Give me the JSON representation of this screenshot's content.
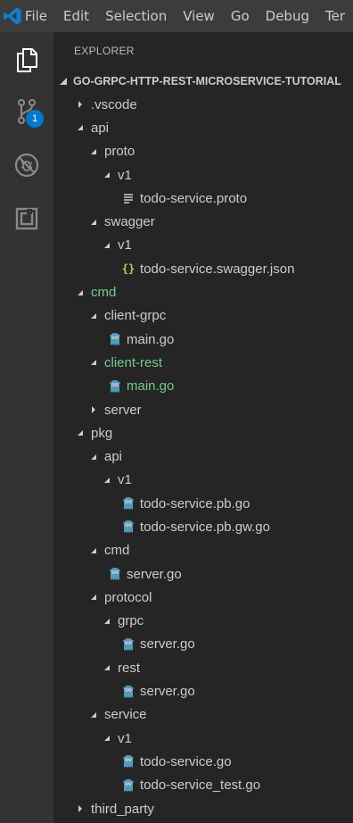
{
  "menu": [
    "File",
    "Edit",
    "Selection",
    "View",
    "Go",
    "Debug",
    "Ter"
  ],
  "activity": {
    "items": [
      {
        "name": "explorer-icon"
      },
      {
        "name": "source-control-icon",
        "badge": "1"
      },
      {
        "name": "debug-icon"
      },
      {
        "name": "extensions-icon"
      }
    ]
  },
  "explorer": {
    "title": "EXPLORER",
    "section": "GO-GRPC-HTTP-REST-MICROSERVICE-TUTORIAL"
  },
  "colors": {
    "accent": "#007acc",
    "git_added": "#73c991",
    "go_icon": "#519aba",
    "json_icon": "#cbcb41"
  },
  "tree": [
    {
      "label": ".vscode",
      "depth": 0,
      "type": "folder",
      "expanded": false
    },
    {
      "label": "api",
      "depth": 0,
      "type": "folder",
      "expanded": true
    },
    {
      "label": "proto",
      "depth": 1,
      "type": "folder",
      "expanded": true
    },
    {
      "label": "v1",
      "depth": 2,
      "type": "folder",
      "expanded": true
    },
    {
      "label": "todo-service.proto",
      "depth": 3,
      "type": "file",
      "icon": "lines-icon"
    },
    {
      "label": "swagger",
      "depth": 1,
      "type": "folder",
      "expanded": true
    },
    {
      "label": "v1",
      "depth": 2,
      "type": "folder",
      "expanded": true
    },
    {
      "label": "todo-service.swagger.json",
      "depth": 3,
      "type": "file",
      "icon": "json-icon"
    },
    {
      "label": "cmd",
      "depth": 0,
      "type": "folder",
      "expanded": true,
      "git": true
    },
    {
      "label": "client-grpc",
      "depth": 1,
      "type": "folder",
      "expanded": true
    },
    {
      "label": "main.go",
      "depth": 2,
      "type": "file",
      "icon": "go-icon"
    },
    {
      "label": "client-rest",
      "depth": 1,
      "type": "folder",
      "expanded": true,
      "git": true
    },
    {
      "label": "main.go",
      "depth": 2,
      "type": "file",
      "icon": "go-icon",
      "git": true
    },
    {
      "label": "server",
      "depth": 1,
      "type": "folder",
      "expanded": false
    },
    {
      "label": "pkg",
      "depth": 0,
      "type": "folder",
      "expanded": true
    },
    {
      "label": "api",
      "depth": 1,
      "type": "folder",
      "expanded": true
    },
    {
      "label": "v1",
      "depth": 2,
      "type": "folder",
      "expanded": true
    },
    {
      "label": "todo-service.pb.go",
      "depth": 3,
      "type": "file",
      "icon": "go-icon"
    },
    {
      "label": "todo-service.pb.gw.go",
      "depth": 3,
      "type": "file",
      "icon": "go-icon"
    },
    {
      "label": "cmd",
      "depth": 1,
      "type": "folder",
      "expanded": true
    },
    {
      "label": "server.go",
      "depth": 2,
      "type": "file",
      "icon": "go-icon"
    },
    {
      "label": "protocol",
      "depth": 1,
      "type": "folder",
      "expanded": true
    },
    {
      "label": "grpc",
      "depth": 2,
      "type": "folder",
      "expanded": true
    },
    {
      "label": "server.go",
      "depth": 3,
      "type": "file",
      "icon": "go-icon"
    },
    {
      "label": "rest",
      "depth": 2,
      "type": "folder",
      "expanded": true
    },
    {
      "label": "server.go",
      "depth": 3,
      "type": "file",
      "icon": "go-icon"
    },
    {
      "label": "service",
      "depth": 1,
      "type": "folder",
      "expanded": true
    },
    {
      "label": "v1",
      "depth": 2,
      "type": "folder",
      "expanded": true
    },
    {
      "label": "todo-service.go",
      "depth": 3,
      "type": "file",
      "icon": "go-icon"
    },
    {
      "label": "todo-service_test.go",
      "depth": 3,
      "type": "file",
      "icon": "go-icon"
    },
    {
      "label": "third_party",
      "depth": 0,
      "type": "folder",
      "expanded": false
    }
  ]
}
